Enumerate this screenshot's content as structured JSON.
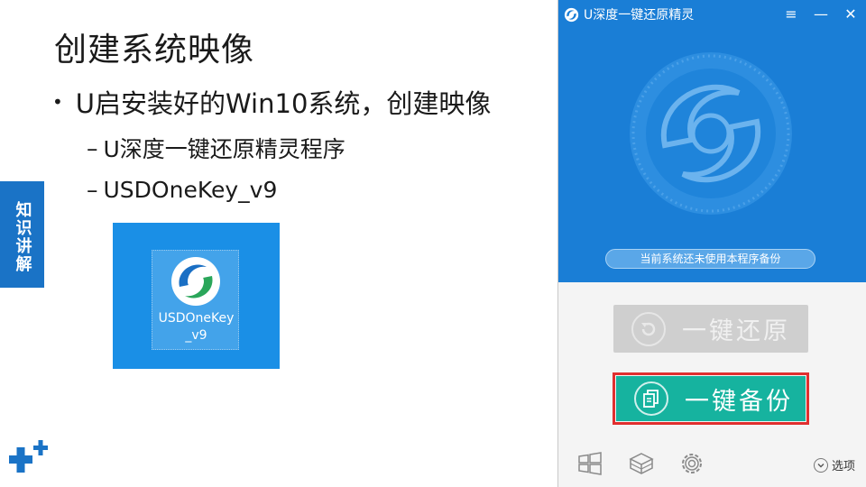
{
  "slide": {
    "title": "创建系统映像",
    "bullet": "U启安装好的Win10系统，创建映像",
    "sub_bullets": [
      "U深度一键还原精灵程序",
      "USDOneKey_v9"
    ],
    "side_tab": "知识讲解"
  },
  "desktop": {
    "icon_label_line1": "USDOneKey",
    "icon_label_line2": "_v9",
    "background_color": "#1a8fe6"
  },
  "app": {
    "title": "U深度一键还原精灵",
    "window_buttons": {
      "menu": "≡",
      "minimize": "—",
      "close": "✕"
    },
    "status": "当前系统还未使用本程序备份",
    "restore_label": "一键还原",
    "backup_label": "一键备份",
    "options_label": "选项",
    "toolbar_icons": [
      "windows-icon",
      "package-icon",
      "gear-icon"
    ],
    "colors": {
      "header": "#1a7ed6",
      "backup": "#16b39f",
      "highlight": "#e02f2f",
      "restore_disabled": "#cfcfcf"
    }
  }
}
